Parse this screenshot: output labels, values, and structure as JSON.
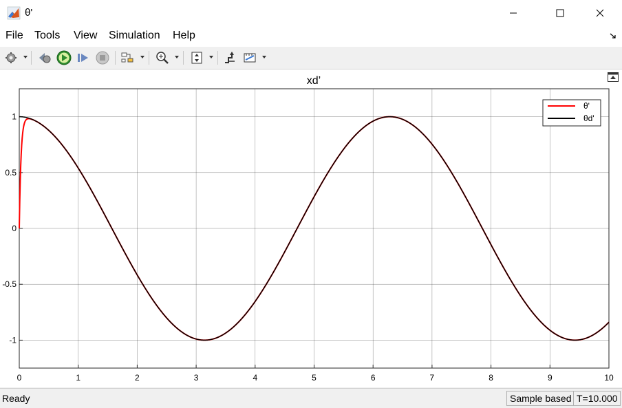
{
  "window": {
    "title": "θ'"
  },
  "menu": {
    "items": [
      "File",
      "Tools",
      "View",
      "Simulation",
      "Help"
    ]
  },
  "toolbar": {
    "icons": [
      "configuration-properties-icon",
      "step-back-icon",
      "run-icon",
      "step-forward-icon",
      "stop-icon",
      "highlight-in-model-icon",
      "zoom-in-icon",
      "autoscale-icon",
      "simulink-trigger-icon",
      "measurements-icon"
    ]
  },
  "status": {
    "ready": "Ready",
    "sample_based": "Sample based",
    "time": "T=10.000"
  },
  "colors": {
    "series1": "#ff0000",
    "series2": "#000000"
  },
  "chart_data": {
    "type": "line",
    "title": "xd’",
    "xlabel": "",
    "ylabel": "",
    "xlim": [
      0,
      10
    ],
    "ylim": [
      -1.25,
      1.25
    ],
    "xticks": [
      "0",
      "1",
      "2",
      "3",
      "4",
      "5",
      "6",
      "7",
      "8",
      "9",
      "10"
    ],
    "yticks": [
      "-1",
      "-0.5",
      "0",
      "0.5",
      "1"
    ],
    "grid": true,
    "legend_position": "top-right",
    "series": [
      {
        "name": "θ'",
        "color": "#ff0000",
        "description_points": [
          [
            0,
            0
          ],
          [
            0.05,
            0.65
          ],
          [
            0.1,
            0.93
          ],
          [
            0.2,
            0.98
          ],
          [
            0.5,
            0.88
          ],
          [
            1,
            0.54
          ],
          [
            1.5,
            0.07
          ],
          [
            2,
            -0.42
          ],
          [
            2.5,
            -0.8
          ],
          [
            3.14,
            -1
          ],
          [
            4,
            -0.65
          ],
          [
            5,
            0.28
          ],
          [
            6,
            0.96
          ],
          [
            6.28,
            1
          ],
          [
            7,
            0.75
          ],
          [
            8,
            -0.15
          ],
          [
            9,
            -0.91
          ],
          [
            9.42,
            -1
          ],
          [
            10,
            -0.84
          ]
        ]
      },
      {
        "name": "θd'",
        "color": "#000000",
        "description_points": [
          [
            0,
            1
          ],
          [
            1,
            0.54
          ],
          [
            2,
            -0.42
          ],
          [
            3.14,
            -1
          ],
          [
            4,
            -0.65
          ],
          [
            5,
            0.28
          ],
          [
            6,
            0.96
          ],
          [
            6.28,
            1
          ],
          [
            7,
            0.75
          ],
          [
            8,
            -0.15
          ],
          [
            9,
            -0.91
          ],
          [
            9.42,
            -1
          ],
          [
            10,
            -0.84
          ]
        ]
      }
    ]
  }
}
